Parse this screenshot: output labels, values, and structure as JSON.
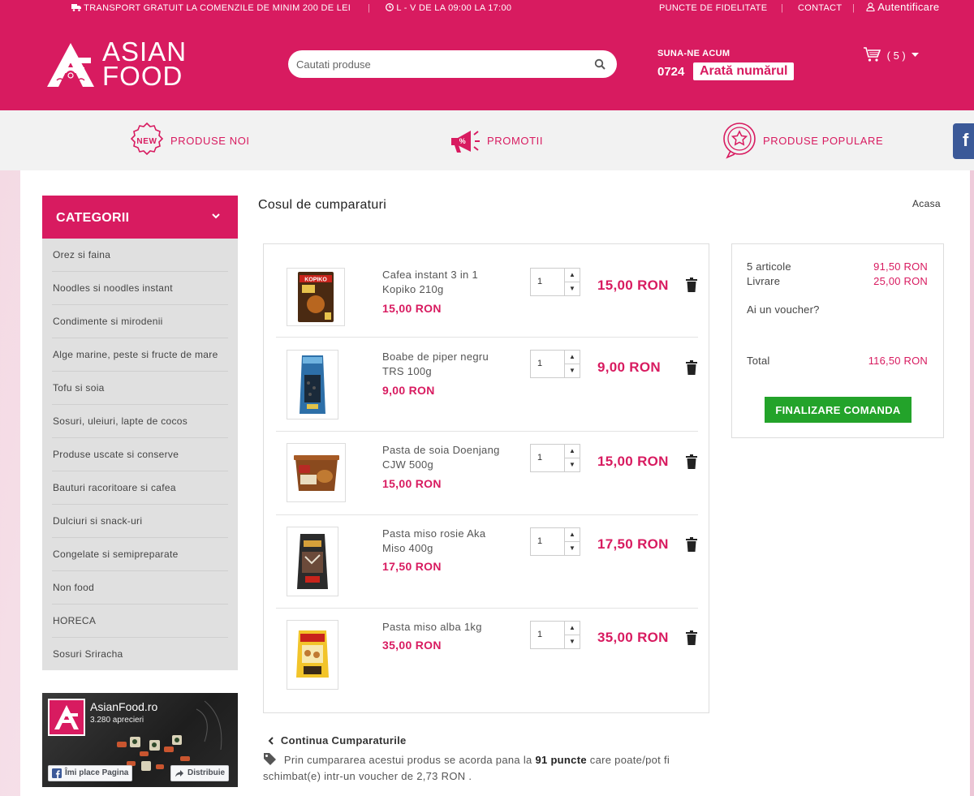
{
  "topbar": {
    "shipping": "TRANSPORT GRATUIT LA COMENZILE DE MINIM 200 DE LEI",
    "hours": "L - V DE LA 09:00 LA 17:00",
    "loyalty": "PUNCTE DE FIDELITATE",
    "contact": "CONTACT",
    "login": "Autentificare"
  },
  "header": {
    "logo_line1": "ASIAN",
    "logo_line2": "FOOD",
    "search_placeholder": "Cautati produse",
    "call_label": "SUNA-NE ACUM",
    "phone_prefix": "0724",
    "show_number": "Arată numărul",
    "cart_count": "( 5 )"
  },
  "nav": {
    "new_badge": "NEW",
    "new_products": "PRODUSE NOI",
    "promotions": "PROMOTII",
    "popular": "PRODUSE POPULARE",
    "facebook": "f"
  },
  "sidebar": {
    "title": "CATEGORII",
    "categories": [
      "Orez si faina",
      "Noodles si noodles instant",
      "Condimente si mirodenii",
      "Alge marine, peste si fructe de mare",
      "Tofu si soia",
      "Sosuri, uleiuri, lapte de cocos",
      "Produse uscate si conserve",
      "Bauturi racoritoare si cafea",
      "Dulciuri si snack-uri",
      "Congelate si semipreparate",
      "Non food",
      "HORECA",
      "Sosuri Sriracha"
    ],
    "fb_page": {
      "name": "AsianFood.ro",
      "likes": "3.280 aprecieri",
      "like_btn": "Îmi place Pagina",
      "share_btn": "Distribuie"
    }
  },
  "page": {
    "title": "Cosul de cumparaturi",
    "breadcrumb": "Acasa"
  },
  "cart": {
    "items": [
      {
        "name": "Cafea instant 3 in 1 Kopiko 210g",
        "price": "15,00 RON",
        "qty": "1",
        "total": "15,00 RON"
      },
      {
        "name": "Boabe de piper negru TRS 100g",
        "price": "9,00 RON",
        "qty": "1",
        "total": "9,00 RON"
      },
      {
        "name": "Pasta de soia Doenjang CJW 500g",
        "price": "15,00 RON",
        "qty": "1",
        "total": "15,00 RON"
      },
      {
        "name": "Pasta miso rosie Aka Miso 400g",
        "price": "17,50 RON",
        "qty": "1",
        "total": "17,50 RON"
      },
      {
        "name": "Pasta miso alba 1kg",
        "price": "35,00 RON",
        "qty": "1",
        "total": "35,00 RON"
      }
    ],
    "continue": "Continua Cumparaturile",
    "points_pre": "Prin cumpararea acestui produs se acorda pana la",
    "points_bold": "91 puncte",
    "points_post": "care poate/pot fi schimbat(e) intr-un voucher de 2,73 RON ."
  },
  "summary": {
    "items_label": "5 articole",
    "items_value": "91,50 RON",
    "shipping_label": "Livrare",
    "shipping_value": "25,00 RON",
    "voucher": "Ai un voucher?",
    "total_label": "Total",
    "total_value": "116,50 RON",
    "checkout": "FINALIZARE COMANDA"
  },
  "colors": {
    "brand": "#d81b60",
    "checkout_green": "#23a32a",
    "facebook": "#3b5998"
  }
}
